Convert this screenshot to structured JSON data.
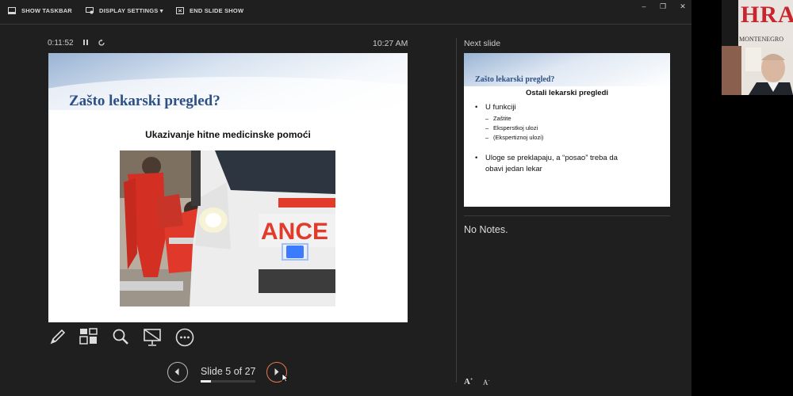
{
  "toolbar": {
    "show_taskbar": "SHOW TASKBAR",
    "display_settings": "DISPLAY SETTINGS ▾",
    "end_slide_show": "END SLIDE SHOW"
  },
  "window_controls": {
    "minimize": "–",
    "restore": "❐",
    "close": "✕"
  },
  "timer": {
    "elapsed": "0:11:52",
    "pause_icon": "pause-icon",
    "restart_icon": "restart-icon"
  },
  "clock": "10:27 AM",
  "current_slide": {
    "title": "Zašto lekarski pregled?",
    "subtitle": "Ukazivanje hitne medicinske pomoći",
    "image_text": "ANCE",
    "accent_color": "#2c4f86"
  },
  "next_slide": {
    "label": "Next slide",
    "title": "Zašto lekarski pregled?",
    "subtitle": "Ostali lekarski pregledi",
    "bullets": [
      {
        "text": "U funkciji",
        "subitems": [
          "Zaštite",
          "Eksperstkoj ulozi",
          "(Ekspertiznoj ulozi)"
        ]
      },
      {
        "text": "Uloge se preklapaju, a “posao” treba da",
        "continuation": "obavi jedan lekar"
      }
    ]
  },
  "notes": {
    "text": "No Notes.",
    "font_increase": "A",
    "font_decrease": "A"
  },
  "tools": [
    "pen-icon",
    "slide-grid-icon",
    "zoom-icon",
    "black-screen-icon",
    "more-options-icon"
  ],
  "navigation": {
    "counter": "Slide 5 of 27",
    "current": 5,
    "total": 27,
    "accent_color": "#e8764a"
  },
  "webcam": {
    "logo_text": "HRA",
    "logo_subtext": "MONTENEGRO"
  }
}
